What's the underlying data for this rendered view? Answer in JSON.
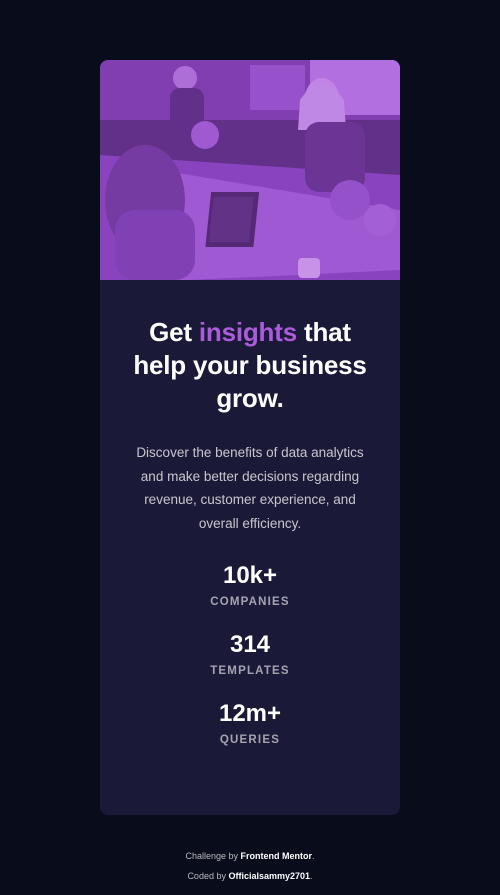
{
  "colors": {
    "page_background": "#090c1b",
    "card_background": "#1b1938",
    "accent": "#ab5cdb",
    "text_primary": "#ffffff"
  },
  "card": {
    "image": {
      "description_icon": "office-team-photo",
      "overlay_color": "#aa5cdb"
    },
    "headline": {
      "prefix": "Get ",
      "accent": "insights",
      "suffix": " that help your business grow."
    },
    "description": "Discover the benefits of data analytics and make better decisions regarding revenue, customer experience, and overall efficiency.",
    "stats": [
      {
        "value": "10k+",
        "label": "COMPANIES"
      },
      {
        "value": "314",
        "label": "TEMPLATES"
      },
      {
        "value": "12m+",
        "label": "QUERIES"
      }
    ]
  },
  "attribution": {
    "challenge_prefix": "Challenge by ",
    "challenge_link": "Frontend Mentor",
    "challenge_suffix": ".",
    "coded_prefix": "Coded by ",
    "coded_link": "Officialsammy2701",
    "coded_suffix": "."
  }
}
